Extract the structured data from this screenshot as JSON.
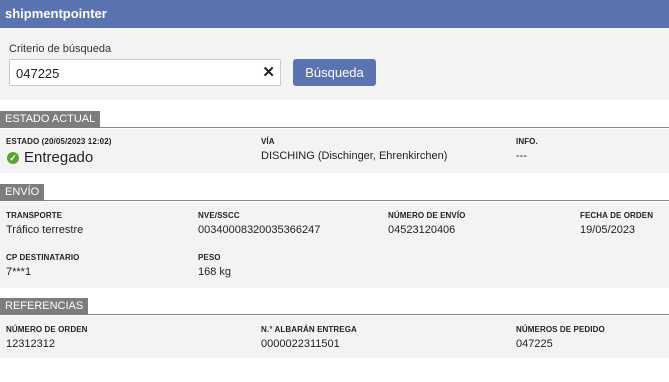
{
  "app": {
    "title": "shipmentpointer"
  },
  "search": {
    "label": "Criterio de búsqueda",
    "value": "047225",
    "clear_icon": "close-icon",
    "button_label": "Búsqueda"
  },
  "estado": {
    "header": "ESTADO ACTUAL",
    "status_label": "ESTADO (20/05/2023 12:02)",
    "status_value": "Entregado",
    "status_icon": "check-circle-icon",
    "status_color": "#58a531",
    "via_label": "VÍA",
    "via_value": "DISCHING (Dischinger, Ehrenkirchen)",
    "info_label": "INFO.",
    "info_value": "---"
  },
  "envio": {
    "header": "ENVÍO",
    "transporte_label": "TRANSPORTE",
    "transporte_value": "Tráfico terrestre",
    "nve_label": "NVE/SSCC",
    "nve_value": "00340008320035366247",
    "numero_envio_label": "NÚMERO DE ENVÍO",
    "numero_envio_value": "04523120406",
    "fecha_orden_label": "FECHA DE ORDEN",
    "fecha_orden_value": "19/05/2023",
    "cp_label": "CP DESTINATARIO",
    "cp_value": "7***1",
    "peso_label": "PESO",
    "peso_value": "168 kg"
  },
  "referencias": {
    "header": "REFERENCIAS",
    "numero_orden_label": "NÚMERO DE ORDEN",
    "numero_orden_value": "12312312",
    "albaran_label": "N.° ALBARÁN ENTREGA",
    "albaran_value": "0000022311501",
    "pedido_label": "NÚMEROS DE PEDIDO",
    "pedido_value": "047225"
  },
  "colors": {
    "brand": "#5b73b0",
    "section_tab": "#7d7d7d",
    "panel_bg": "#f3f3f3"
  }
}
